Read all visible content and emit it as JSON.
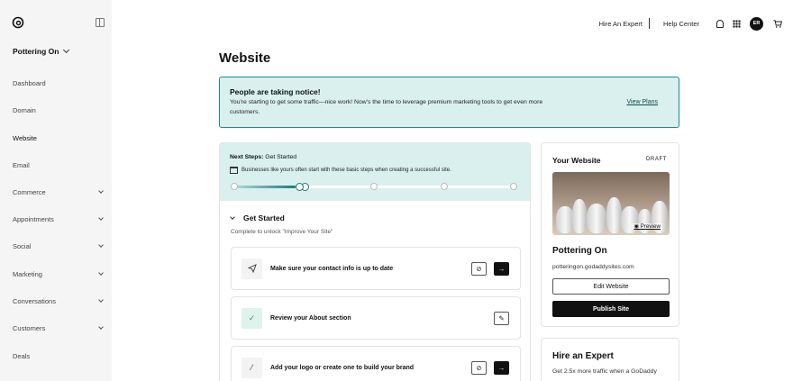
{
  "sidebar": {
    "site_name": "Pottering On",
    "items": [
      {
        "label": "Dashboard",
        "expandable": false
      },
      {
        "label": "Domain",
        "expandable": false
      },
      {
        "label": "Website",
        "expandable": false,
        "active": true
      },
      {
        "label": "Email",
        "expandable": false
      },
      {
        "label": "Commerce",
        "expandable": true
      },
      {
        "label": "Appointments",
        "expandable": true
      },
      {
        "label": "Social",
        "expandable": true
      },
      {
        "label": "Marketing",
        "expandable": true
      },
      {
        "label": "Conversations",
        "expandable": true
      },
      {
        "label": "Customers",
        "expandable": true
      },
      {
        "label": "Deals",
        "expandable": false
      }
    ]
  },
  "topbar": {
    "hire_expert": "Hire An Expert",
    "help_center": "Help Center",
    "avatar_initials": "ER"
  },
  "page": {
    "title": "Website"
  },
  "notice": {
    "title": "People are taking notice!",
    "body": "You're starting to get some traffic—nice work! Now's the time to leverage premium marketing tools to get even more customers.",
    "link": "View Plans"
  },
  "next_steps": {
    "label": "Next Steps:",
    "value": "Get Started",
    "hint": "Businesses like yours often start with these basic steps when creating a successful site.",
    "progress_fraction": 0.12,
    "total_stages": 5,
    "current_stage": 2
  },
  "get_started": {
    "title": "Get Started",
    "subtitle": "Complete to unlock \"Improve Your Site\"",
    "tasks": [
      {
        "label": "Make sure your contact info is up to date",
        "icon": "send-icon",
        "done": false,
        "has_hide": true,
        "has_go": true
      },
      {
        "label": "Review your About section",
        "icon": "check-icon",
        "done": true,
        "has_hide": false,
        "has_edit": true
      },
      {
        "label": "Add your logo or create one to build your brand",
        "icon": "magic-wand-icon",
        "done": false,
        "has_hide": true,
        "has_go": true
      }
    ]
  },
  "your_website": {
    "title": "Your Website",
    "status": "DRAFT",
    "preview_label": "Preview",
    "site_name": "Pottering On",
    "url": "potteringon.godaddysites.com",
    "edit_label": "Edit Website",
    "publish_label": "Publish Site"
  },
  "hire_expert_card": {
    "title": "Hire an Expert",
    "desc": "Get 2.5x more traffic when a GoDaddy"
  },
  "colors": {
    "accent_teal": "#1b8b88",
    "notice_bg": "#d9f0ef",
    "sidebar_bg": "#f5f5f5"
  }
}
